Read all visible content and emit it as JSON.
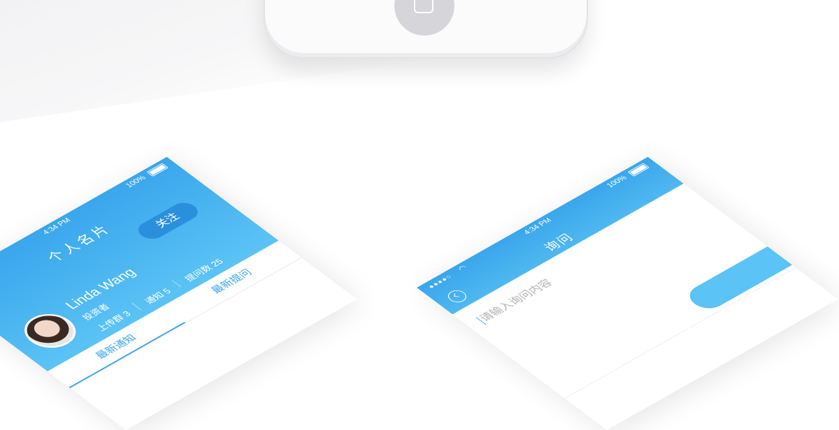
{
  "left_phone": {
    "status": {
      "time": "4:34 PM",
      "battery": "100%"
    },
    "title": "个人名片",
    "follow_label": "关注",
    "user": {
      "name": "Linda Wang",
      "role": "投资者"
    },
    "stats": [
      {
        "label": "上传群 3"
      },
      {
        "label": "通知 5"
      },
      {
        "label": "提问数 25"
      }
    ],
    "tabs": [
      {
        "label": "最新通知"
      },
      {
        "label": "最新提问"
      }
    ]
  },
  "right_phone": {
    "status": {
      "time": "4:34 PM",
      "battery": "100%",
      "signal": "●●●●○"
    },
    "title": "询问",
    "input_placeholder": "请输入询问内容"
  },
  "colors": {
    "primary_blue": "#3aa6ec",
    "light_blue": "#5bc3f5",
    "button_blue": "#2a90dc"
  },
  "icons": [
    "home-button-icon",
    "battery-icon",
    "wifi-icon",
    "back-icon",
    "avatar"
  ]
}
